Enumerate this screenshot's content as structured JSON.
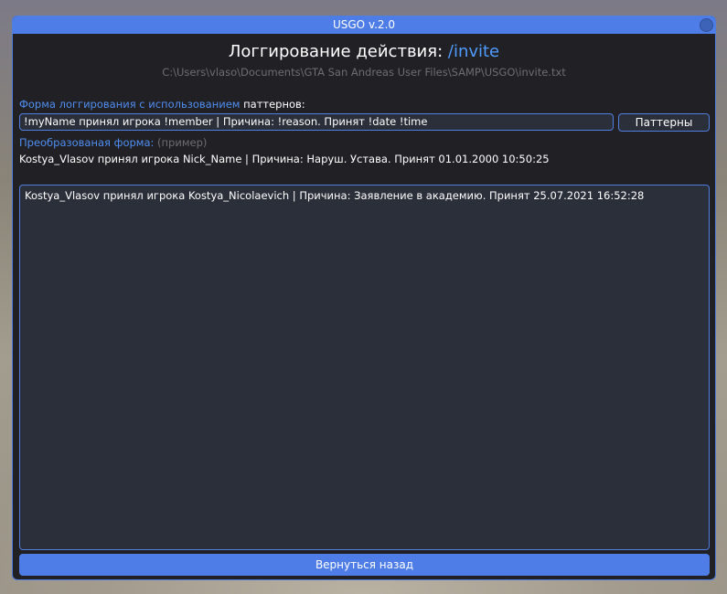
{
  "window": {
    "title": "USGO v.2.0"
  },
  "heading": {
    "prefix": "Логгирование действия: ",
    "command": "/invite"
  },
  "file_path": "C:\\Users\\vlaso\\Documents\\GTA San Andreas User Files\\SAMP\\USGO\\invite.txt",
  "pattern_form": {
    "label_blue": "Форма логгирования с использованием",
    "label_white": " паттернов:",
    "value": "!myName принял игрока !member | Причина: !reason. Принят !date !time",
    "patterns_button": "Паттерны"
  },
  "converted": {
    "label_blue": "Преобразованая форма:",
    "label_grey": " (пример)",
    "example": "Kostya_Vlasov принял игрока Nick_Name | Причина: Наруш. Устава. Принят 01.01.2000 10:50:25"
  },
  "log": {
    "text": "Kostya_Vlasov принял игрока Kostya_Nicolaevich | Причина: Заявление в академию. Принят 25.07.2021 16:52:28"
  },
  "back_button": "Вернуться назад",
  "colors": {
    "accent": "#4f7de8",
    "window_bg": "#212125",
    "field_bg": "#2b2f3a"
  }
}
